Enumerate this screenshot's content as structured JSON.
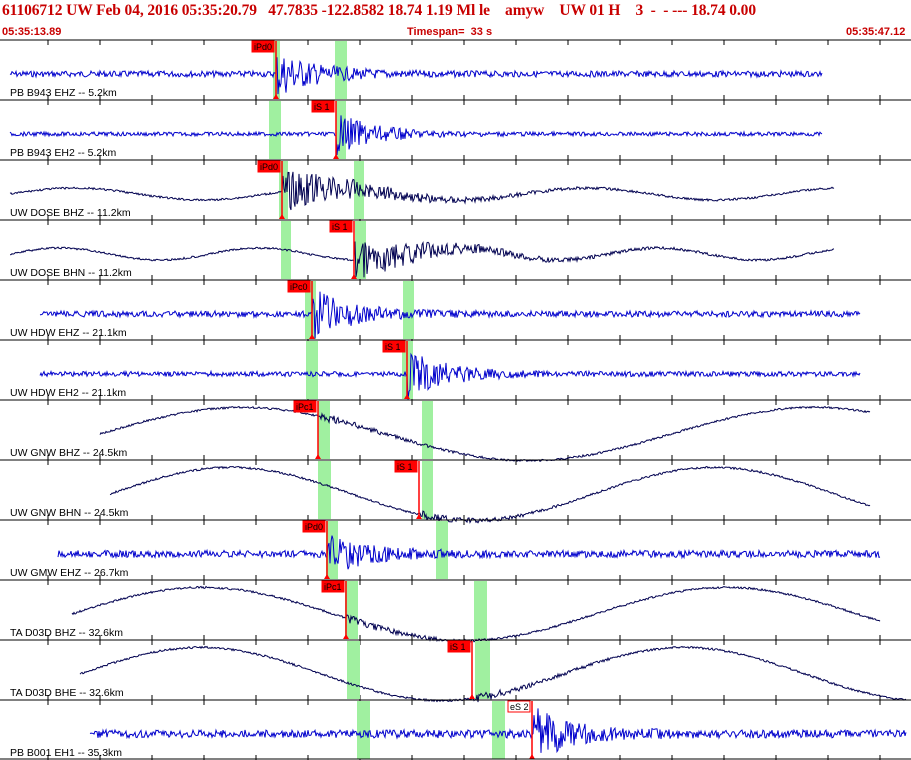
{
  "header": {
    "title": "61106712 UW Feb 04, 2016 05:35:20.79   47.7835 -122.8582 18.74 1.19 Ml le    amyw    UW 01 H    3  -  - --- 18.74 0.00",
    "start_time": "05:35:13.89",
    "timespan": "Timespan=  33 s",
    "end_time": "05:35:47.12"
  },
  "colors": {
    "waveform_blue": "#0000cc",
    "waveform_dark": "#000050",
    "pick_red": "#ff0000",
    "window_green": "#a0f0a0",
    "header_red": "#c80000",
    "grid_black": "#000000"
  },
  "traces": [
    {
      "label": "PB B943 EHZ -- 5.2km",
      "color": "blue",
      "style": "burst",
      "pick": {
        "label": "iPd0"
      }
    },
    {
      "label": "PB B943 EH2 -- 5.2km",
      "color": "blue",
      "style": "burst",
      "pick": {
        "label": "iS 1"
      }
    },
    {
      "label": "UW DOSE BHZ -- 11.2km",
      "color": "dark",
      "style": "wave",
      "pick": {
        "label": "iPd0"
      }
    },
    {
      "label": "UW DOSE BHN -- 11.2km",
      "color": "dark",
      "style": "wave",
      "pick": {
        "label": "iS 1"
      }
    },
    {
      "label": "UW HDW EHZ -- 21.1km",
      "color": "blue",
      "style": "burst",
      "pick": {
        "label": "iPc0"
      }
    },
    {
      "label": "UW HDW EH2 -- 21.1km",
      "color": "blue",
      "style": "burst",
      "pick": {
        "label": "iS 1"
      }
    },
    {
      "label": "UW GNW BHZ -- 24.5km",
      "color": "dark",
      "style": "long",
      "pick": {
        "label": "iPc1"
      }
    },
    {
      "label": "UW GNW BHN -- 24.5km",
      "color": "dark",
      "style": "long",
      "pick": {
        "label": "iS 1"
      }
    },
    {
      "label": "UW GMW EHZ -- 26.7km",
      "color": "blue",
      "style": "burst",
      "pick": {
        "label": "iPd0"
      }
    },
    {
      "label": "TA D03D BHZ -- 32.6km",
      "color": "dark",
      "style": "long",
      "pick": {
        "label": "iPc1"
      }
    },
    {
      "label": "TA D03D BHE -- 32.6km",
      "color": "dark",
      "style": "long",
      "pick": {
        "label": "iS 1"
      }
    },
    {
      "label": "PB B001 EH1 -- 35.3km",
      "color": "blue",
      "style": "burst",
      "pick": {
        "label": "eS 2"
      }
    }
  ]
}
